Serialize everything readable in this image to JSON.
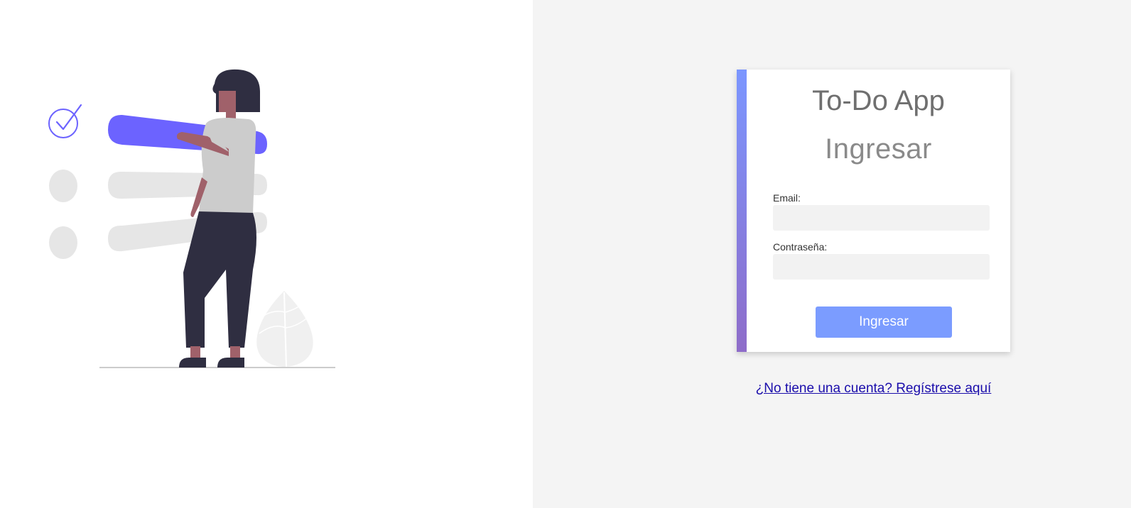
{
  "app": {
    "title": "To-Do App"
  },
  "login": {
    "heading": "Ingresar",
    "email_label": "Email:",
    "email_value": "",
    "password_label": "Contraseña:",
    "password_value": "",
    "submit_label": "Ingresar"
  },
  "register_link": {
    "label": "¿No tiene una cuenta? Regístrese aquí"
  },
  "colors": {
    "accent_top": "#7b96ff",
    "accent_bottom": "#8e6cc9",
    "button": "#7b9cff",
    "illustration_primary": "#6c63ff",
    "illustration_neutral": "#e6e6e6",
    "link": "#1a0dab",
    "right_panel_bg": "#f4f4f4"
  },
  "illustration": {
    "icon": "todo-list-woman-illustration"
  }
}
